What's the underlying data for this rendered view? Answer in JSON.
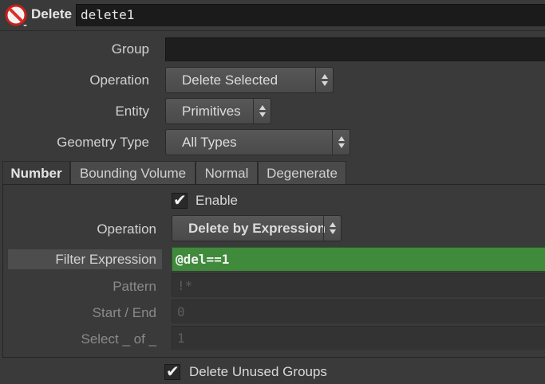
{
  "header": {
    "node_type": "Delete",
    "node_name": "delete1",
    "icon": "no-entry-icon"
  },
  "params": {
    "group_label": "Group",
    "group_value": "",
    "operation_label": "Operation",
    "operation_value": "Delete Selected",
    "entity_label": "Entity",
    "entity_value": "Primitives",
    "geometry_type_label": "Geometry Type",
    "geometry_type_value": "All Types"
  },
  "tabs": [
    {
      "label": "Number",
      "active": true
    },
    {
      "label": "Bounding Volume",
      "active": false
    },
    {
      "label": "Normal",
      "active": false
    },
    {
      "label": "Degenerate",
      "active": false
    }
  ],
  "number_tab": {
    "enable_label": "Enable",
    "enable_checked": true,
    "operation_label": "Operation",
    "operation_value": "Delete by Expression",
    "filter_label": "Filter Expression",
    "filter_value": "@del==1",
    "pattern_label": "Pattern",
    "pattern_value": "!*",
    "start_end_label": "Start / End",
    "start_end_value": "0",
    "select_of_label": "Select _ of _",
    "select_of_value": "1"
  },
  "footer": {
    "delete_unused_label": "Delete Unused Groups",
    "delete_unused_checked": true
  },
  "colors": {
    "background": "#3a3a3a",
    "field": "#1e1e1e",
    "expression_green": "#3f8a3b",
    "icon_red": "#d9302a"
  }
}
